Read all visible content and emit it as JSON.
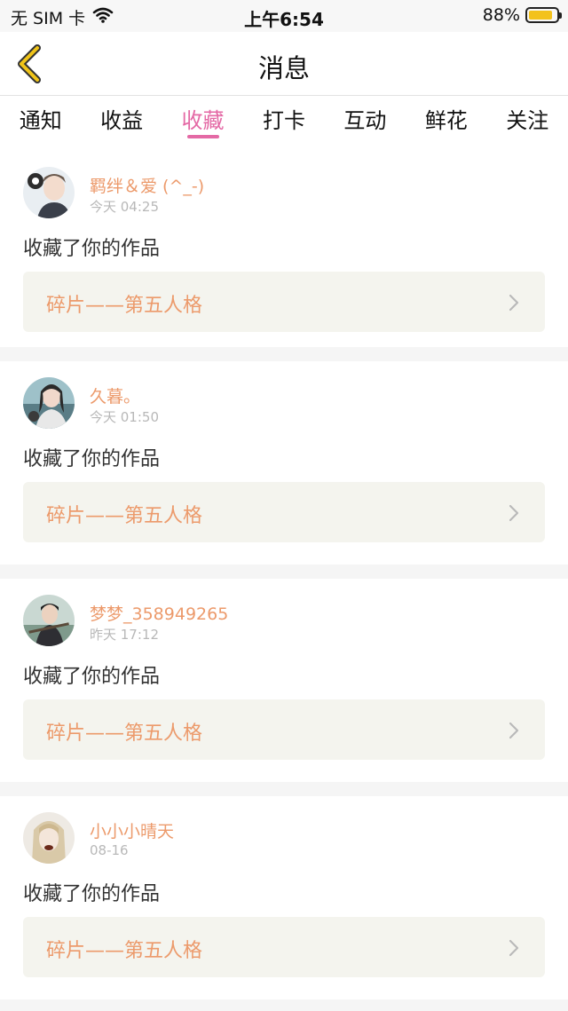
{
  "status_bar": {
    "carrier": "无 SIM 卡",
    "time": "上午6:54",
    "battery": "88%",
    "battery_color": "#f3c21c"
  },
  "nav": {
    "title": "消息",
    "back_icon": "chevron-left-icon",
    "accent_color": "#f0c419"
  },
  "tabs": [
    {
      "label": "通知",
      "active": false
    },
    {
      "label": "收益",
      "active": false
    },
    {
      "label": "收藏",
      "active": true
    },
    {
      "label": "打卡",
      "active": false
    },
    {
      "label": "互动",
      "active": false
    },
    {
      "label": "鲜花",
      "active": false
    },
    {
      "label": "关注",
      "active": false
    }
  ],
  "theme": {
    "active_tab_color": "#e469a5",
    "username_color": "#ec9a6b",
    "work_box_bg": "#f4f4ee"
  },
  "messages": [
    {
      "username": "羁绊＆爱 (^_-)",
      "time": "今天 04:25",
      "action": "收藏了你的作品",
      "work": "碎片——第五人格"
    },
    {
      "username": "久暮。",
      "time": "今天 01:50",
      "action": "收藏了你的作品",
      "work": "碎片——第五人格"
    },
    {
      "username": "梦梦_358949265",
      "time": "昨天 17:12",
      "action": "收藏了你的作品",
      "work": "碎片——第五人格"
    },
    {
      "username": "小小小晴天",
      "time": "08-16",
      "action": "收藏了你的作品",
      "work": "碎片——第五人格"
    }
  ]
}
